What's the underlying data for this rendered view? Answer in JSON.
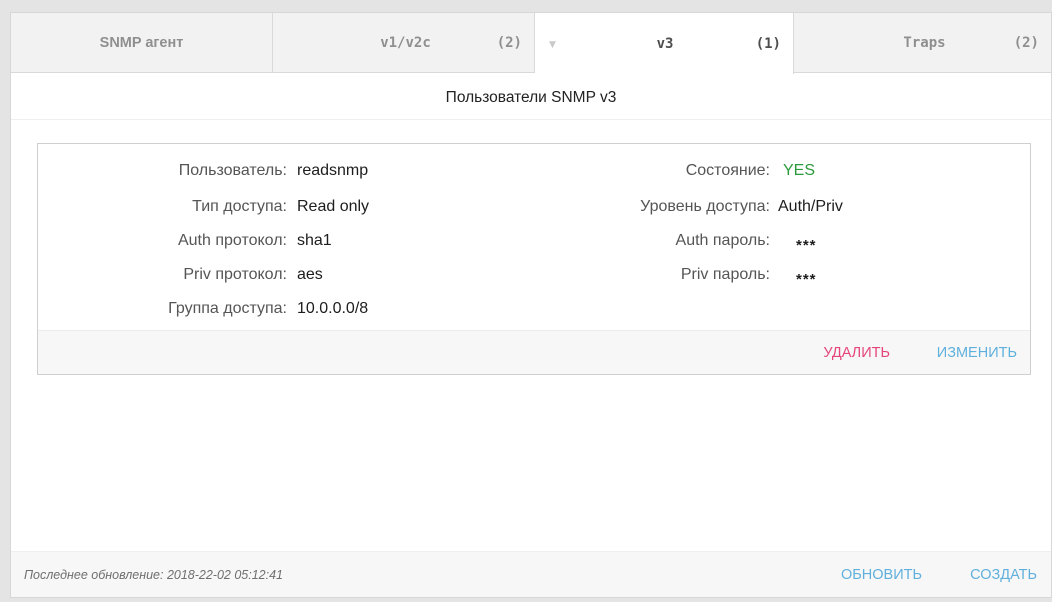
{
  "tabs": [
    {
      "label": "SNMP агент",
      "count": ""
    },
    {
      "label": "v1/v2c",
      "count": "(2)"
    },
    {
      "label": "v3",
      "count": "(1)"
    },
    {
      "label": "Traps",
      "count": "(2)"
    }
  ],
  "section_title": "Пользователи SNMP v3",
  "user": {
    "user_label": "Пользователь:",
    "user_value": "readsnmp",
    "access_type_label": "Тип доступа:",
    "access_type_value": "Read only",
    "auth_protocol_label": "Auth протокол:",
    "auth_protocol_value": "sha1",
    "priv_protocol_label": "Priv протокол:",
    "priv_protocol_value": "aes",
    "group_label": "Группа доступа:",
    "group_value": "10.0.0.0/8",
    "state_label": "Состояние:",
    "state_value": "YES",
    "level_label": "Уровень доступа:",
    "level_value": "Auth/Priv",
    "auth_password_label": "Auth пароль:",
    "auth_password_value": "***",
    "priv_password_label": "Priv пароль:",
    "priv_password_value": "***"
  },
  "card_actions": {
    "delete_label": "УДАЛИТЬ",
    "edit_label": "ИЗМЕНИТЬ"
  },
  "footer": {
    "last_update": "Последнее обновление: 2018-22-02 05:12:41",
    "refresh_label": "ОБНОВИТЬ",
    "create_label": "СОЗДАТЬ"
  },
  "colors": {
    "accent_link": "#5fb0dd",
    "danger": "#e5457a",
    "status_yes": "#2a9a3a"
  },
  "icons": {
    "active_tab_marker": "caret-down-icon"
  }
}
